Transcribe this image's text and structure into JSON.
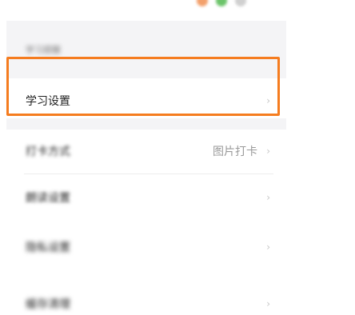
{
  "settings": {
    "section_header": "学习提醒",
    "learning_settings": {
      "label": "学习设置",
      "chevron": "›"
    },
    "check_in": {
      "label": "打卡方式",
      "value": "图片打卡",
      "chevron": "›"
    },
    "row_3": {
      "label": "朗读设置",
      "chevron": "›"
    },
    "row_4": {
      "label": "隐私设置",
      "chevron": "›"
    },
    "row_5": {
      "label": "缓存清理",
      "chevron": "›"
    }
  },
  "colors": {
    "highlight": "#f57c1f",
    "pill_orange": "#f3a06b",
    "pill_green": "#6cc46a",
    "pill_gray": "#d0d0d0"
  }
}
